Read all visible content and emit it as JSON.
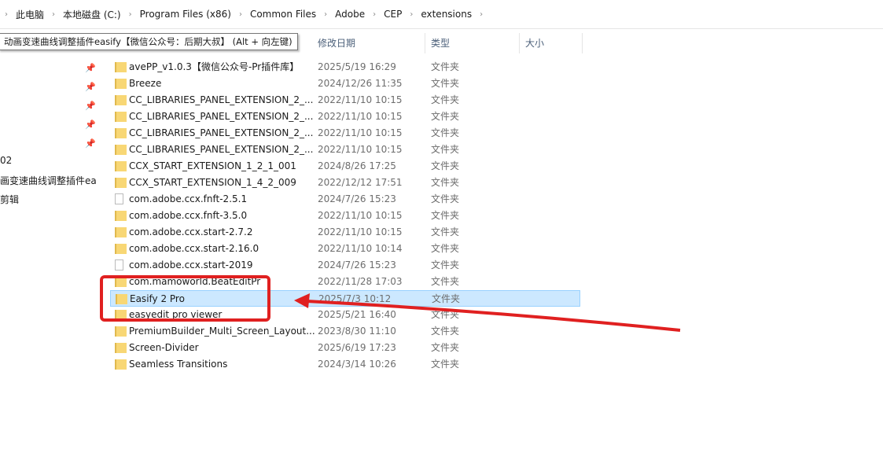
{
  "breadcrumb": [
    "此电脑",
    "本地磁盘 (C:)",
    "Program Files (x86)",
    "Common Files",
    "Adobe",
    "CEP",
    "extensions"
  ],
  "tooltip": "动画变速曲线调整插件easify【微信公众号：后期大叔】 (Alt + 向左键)",
  "columns": {
    "date": "修改日期",
    "type": "类型",
    "size": "大小"
  },
  "nav": [
    "02",
    "画变速曲线调整插件easify",
    "剪辑"
  ],
  "files": [
    {
      "name": "avePP_v1.0.3【微信公众号-Pr插件库】",
      "date": "2025/5/19 16:29",
      "type": "文件夹",
      "icon": "folder"
    },
    {
      "name": "Breeze",
      "date": "2024/12/26 11:35",
      "type": "文件夹",
      "icon": "folder"
    },
    {
      "name": "CC_LIBRARIES_PANEL_EXTENSION_2_...",
      "date": "2022/11/10 10:15",
      "type": "文件夹",
      "icon": "folder"
    },
    {
      "name": "CC_LIBRARIES_PANEL_EXTENSION_2_...",
      "date": "2022/11/10 10:15",
      "type": "文件夹",
      "icon": "folder"
    },
    {
      "name": "CC_LIBRARIES_PANEL_EXTENSION_2_...",
      "date": "2022/11/10 10:15",
      "type": "文件夹",
      "icon": "folder"
    },
    {
      "name": "CC_LIBRARIES_PANEL_EXTENSION_2_...",
      "date": "2022/11/10 10:15",
      "type": "文件夹",
      "icon": "folder"
    },
    {
      "name": "CCX_START_EXTENSION_1_2_1_001",
      "date": "2024/8/26 17:25",
      "type": "文件夹",
      "icon": "folder"
    },
    {
      "name": "CCX_START_EXTENSION_1_4_2_009",
      "date": "2022/12/12 17:51",
      "type": "文件夹",
      "icon": "folder"
    },
    {
      "name": "com.adobe.ccx.fnft-2.5.1",
      "date": "2024/7/26 15:23",
      "type": "文件夹",
      "icon": "file"
    },
    {
      "name": "com.adobe.ccx.fnft-3.5.0",
      "date": "2022/11/10 10:15",
      "type": "文件夹",
      "icon": "folder"
    },
    {
      "name": "com.adobe.ccx.start-2.7.2",
      "date": "2022/11/10 10:15",
      "type": "文件夹",
      "icon": "folder"
    },
    {
      "name": "com.adobe.ccx.start-2.16.0",
      "date": "2022/11/10 10:14",
      "type": "文件夹",
      "icon": "folder"
    },
    {
      "name": "com.adobe.ccx.start-2019",
      "date": "2024/7/26 15:23",
      "type": "文件夹",
      "icon": "file"
    },
    {
      "name": "com.mamoworld.BeatEditPr",
      "date": "2022/11/28 17:03",
      "type": "文件夹",
      "icon": "folder"
    },
    {
      "name": "Easify 2 Pro",
      "date": "2025/7/3 10:12",
      "type": "文件夹",
      "icon": "folder",
      "selected": true
    },
    {
      "name": "easyedit pro viewer",
      "date": "2025/5/21 16:40",
      "type": "文件夹",
      "icon": "folder"
    },
    {
      "name": "PremiumBuilder_Multi_Screen_Layout...",
      "date": "2023/8/30 11:10",
      "type": "文件夹",
      "icon": "folder"
    },
    {
      "name": "Screen-Divider",
      "date": "2025/6/19 17:23",
      "type": "文件夹",
      "icon": "folder"
    },
    {
      "name": "Seamless Transitions",
      "date": "2024/3/14 10:26",
      "type": "文件夹",
      "icon": "folder"
    }
  ],
  "annotation_color": "#e02020"
}
